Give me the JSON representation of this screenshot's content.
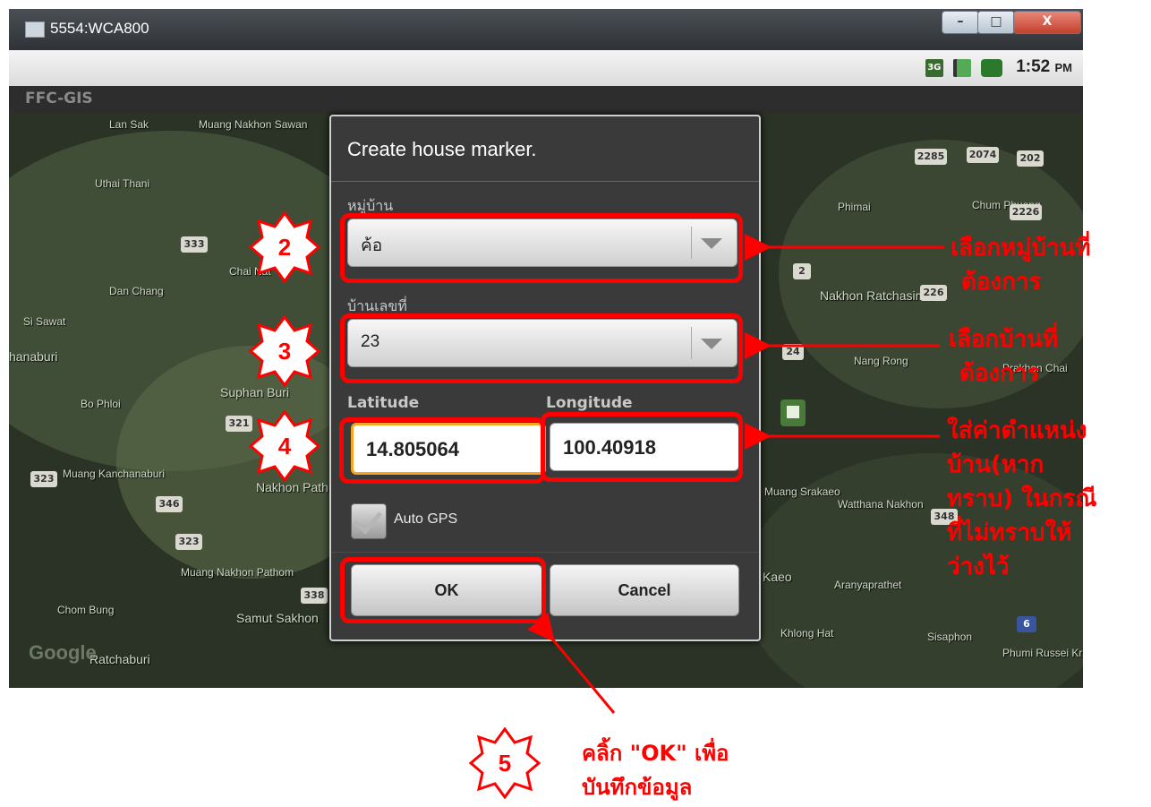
{
  "window": {
    "title": "5554:WCA800",
    "controls": {
      "min": "–",
      "max": "□",
      "close": "X"
    }
  },
  "status_bar": {
    "network": "3G",
    "time": "1:52",
    "ampm": "PM"
  },
  "app": {
    "title": "FFC-GIS"
  },
  "map": {
    "labels": [
      "Lan Sak",
      "Muang Nakhon Sawan",
      "Uthai Thani",
      "Dan Chang",
      "Si Sawat",
      "Chai Nat",
      "hanaburi",
      "Bo Phloi",
      "Suphan Buri",
      "Muang Kanchanaburi",
      "Nakhon Pathom",
      "Muang Nakhon Pathom",
      "Chom Bung",
      "Samut Sakhon",
      "Ratchaburi",
      "Phimai",
      "Chum Phuang",
      "Nakhon Ratchasima",
      "Nang Rong",
      "Prakhon Chai",
      "Muang Srakaeo",
      "Watthana Nakhon",
      "Kaeo",
      "Aranyaprathet",
      "Khlong Hat",
      "Sisaphon",
      "Phumi Russei Kraok"
    ],
    "shields": [
      "333",
      "321",
      "323",
      "346",
      "323",
      "338",
      "2285",
      "2074",
      "202",
      "2226",
      "226",
      "2",
      "24",
      "348",
      "6"
    ],
    "logo": "Google"
  },
  "dialog": {
    "title": "Create house marker.",
    "village_label": "หมู่บ้าน",
    "village_value": "ค้อ",
    "house_label": "บ้านเลขที่",
    "house_value": "23",
    "lat_label": "Latitude",
    "lat_value": "14.805064",
    "lon_label": "Longitude",
    "lon_value": "100.40918",
    "auto_gps_label": "Auto GPS",
    "ok_label": "OK",
    "cancel_label": "Cancel"
  },
  "annotations": {
    "steps": [
      "2",
      "3",
      "4",
      "5"
    ],
    "note_village": [
      "เลือกหมู่บ้านที่",
      "ต้องการ"
    ],
    "note_house": [
      "เลือกบ้านที่",
      "ต้องการ"
    ],
    "note_coords": [
      "ใส่ค่าตำแหน่ง",
      "บ้าน(หาก",
      "ทราบ) ในกรณี",
      "ที่ไม่ทราบให้",
      "ว่างไว้"
    ],
    "note_ok": [
      "คลิ้ก \"OK\" เพื่อ",
      "บันทึกข้อมูล"
    ],
    "color": "#ff0000"
  },
  "colors": {
    "dialog_bg": "#3a3a3a",
    "map_bg": "#2a3326",
    "highlight": "#f5a623"
  }
}
